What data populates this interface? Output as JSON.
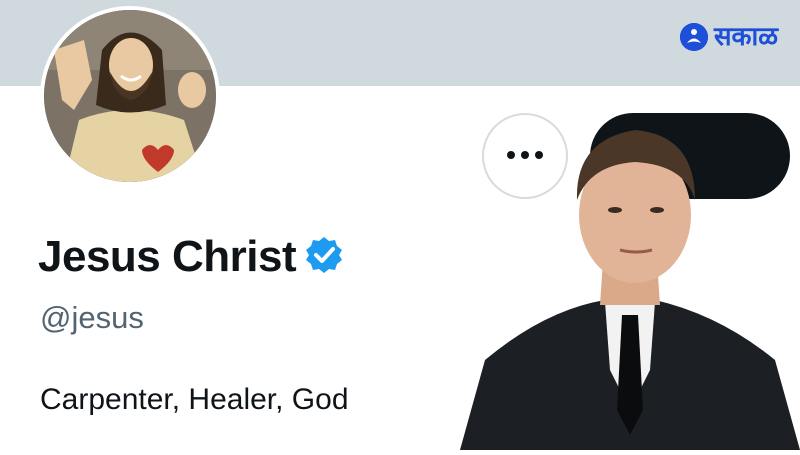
{
  "brand": {
    "logo_text": "सकाळ",
    "accent": "#1d4fd8"
  },
  "profile": {
    "display_name": "Jesus Christ",
    "verified": true,
    "verified_color": "#1d9bf0",
    "handle": "@jesus",
    "bio": "Carpenter, Healer, God"
  },
  "actions": {
    "more_icon": "more-horizontal-icon"
  },
  "colors": {
    "banner": "#cfd9de",
    "text": "#0f1419",
    "muted": "#536471"
  }
}
